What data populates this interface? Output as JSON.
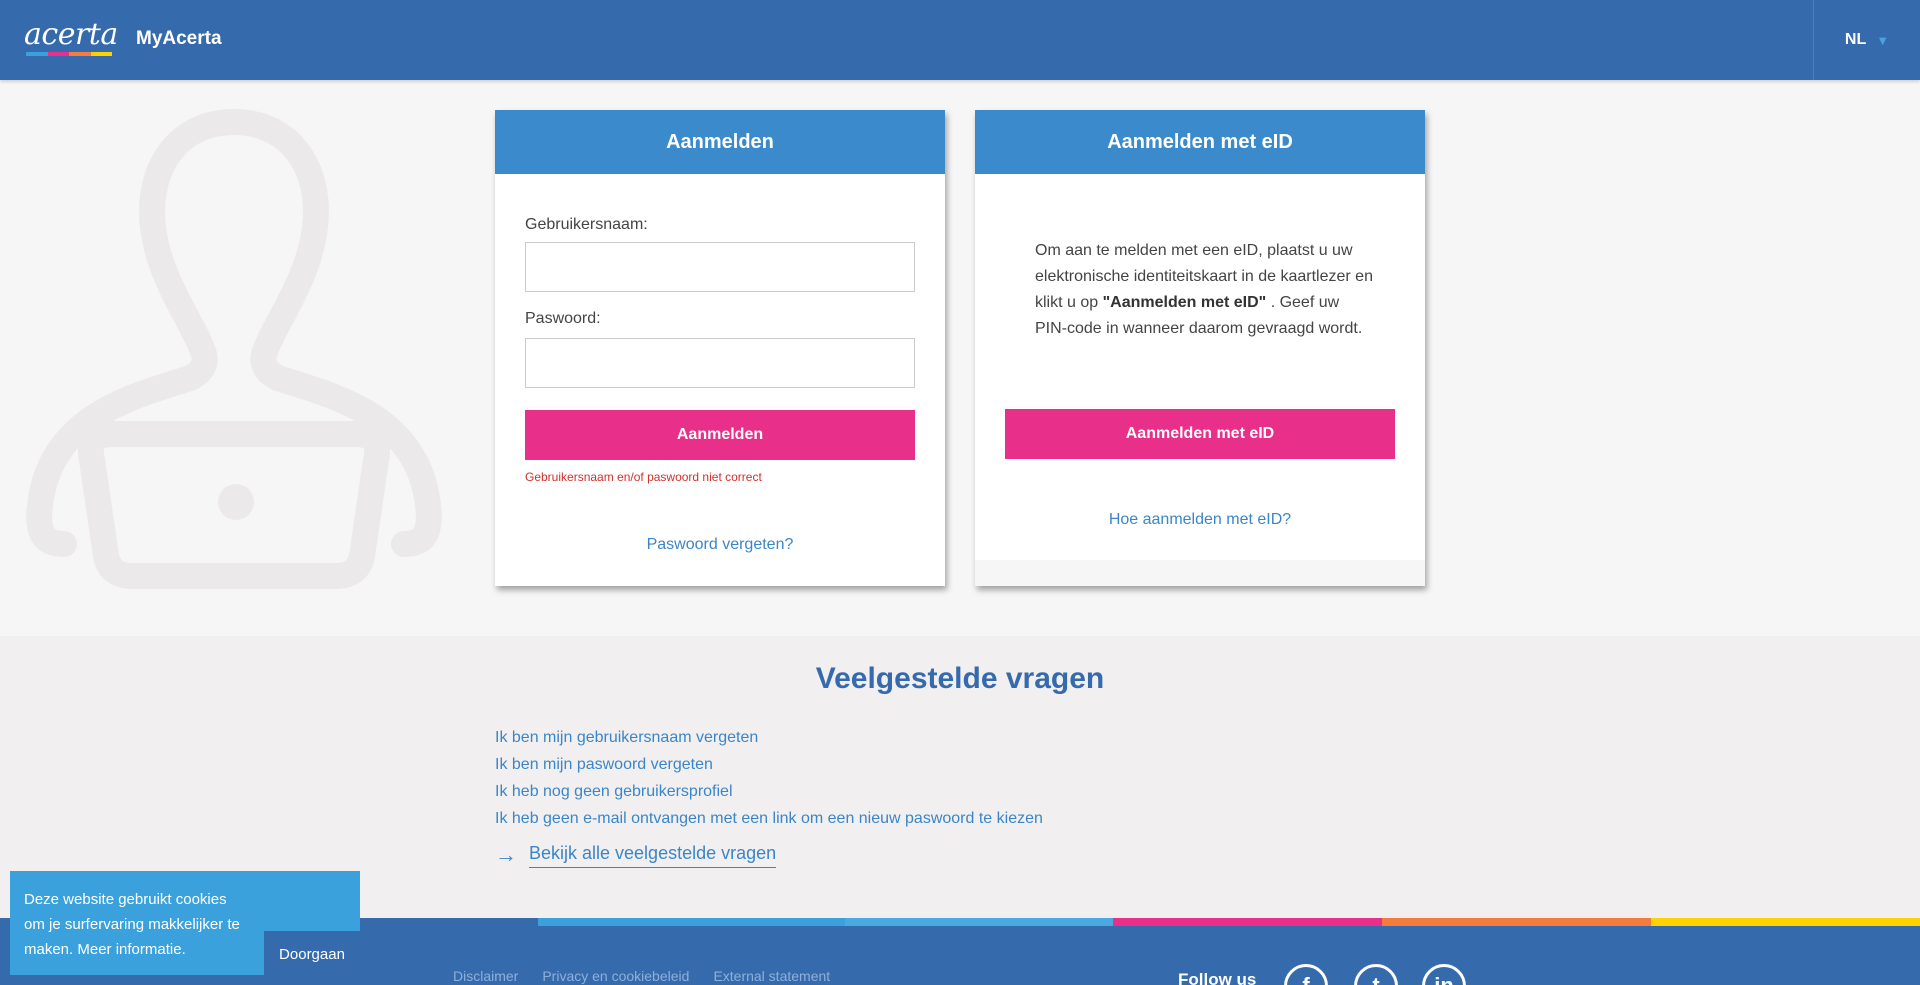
{
  "header": {
    "logo_text": "acerta",
    "app_name": "MyAcerta",
    "language": "NL",
    "logo_bar_colors": [
      "#3aa1dd",
      "#e8308a",
      "#f47c3c",
      "#ffd200"
    ]
  },
  "login": {
    "title": "Aanmelden",
    "username_label": "Gebruikersnaam:",
    "username_value": "",
    "password_label": "Paswoord:",
    "password_value": "",
    "submit_label": "Aanmelden",
    "error": "Gebruikersnaam en/of paswoord niet correct",
    "forgot_link": "Paswoord vergeten?"
  },
  "eid": {
    "title": "Aanmelden met eID",
    "text_before": "Om aan te melden met een eID, plaatst u uw elektronische identiteitskaart in de kaartlezer en klikt u op ",
    "text_bold": "\"Aanmelden met eID\"",
    "text_after": " . Geef uw PIN-code in wanneer daarom gevraagd wordt.",
    "button_label": "Aanmelden met eID",
    "help_link": "Hoe aanmelden met eID?"
  },
  "faq": {
    "title": "Veelgestelde vragen",
    "items": [
      "Ik ben mijn gebruikersnaam vergeten",
      "Ik ben mijn paswoord vergeten",
      "Ik heb nog geen gebruikersprofiel",
      "Ik heb geen e-mail ontvangen met een link om een nieuw paswoord te kiezen"
    ],
    "all_link": "Bekijk alle veelgestelde vragen"
  },
  "footer": {
    "links": [
      "Disclaimer",
      "Privacy en cookiebeleid",
      "External statement"
    ],
    "follow_label": "Follow us",
    "social": [
      "facebook-icon",
      "twitter-icon",
      "linkedin-icon"
    ],
    "stripe_colors": [
      "#356aad",
      "#3aa1dd",
      "#4aa9e3",
      "#e8308a",
      "#f47c3c",
      "#ffd200"
    ]
  },
  "cookie": {
    "text": "Deze website gebruikt cookies om je surfervaring makkelijker te maken.",
    "more_link": "Meer informatie.",
    "accept_label": "Doorgaan"
  },
  "colors": {
    "header_blue": "#356aad",
    "card_header_blue": "#3b8bcc",
    "accent_pink": "#e8308a",
    "link_blue": "#3a86c8",
    "error_red": "#d0312d"
  }
}
